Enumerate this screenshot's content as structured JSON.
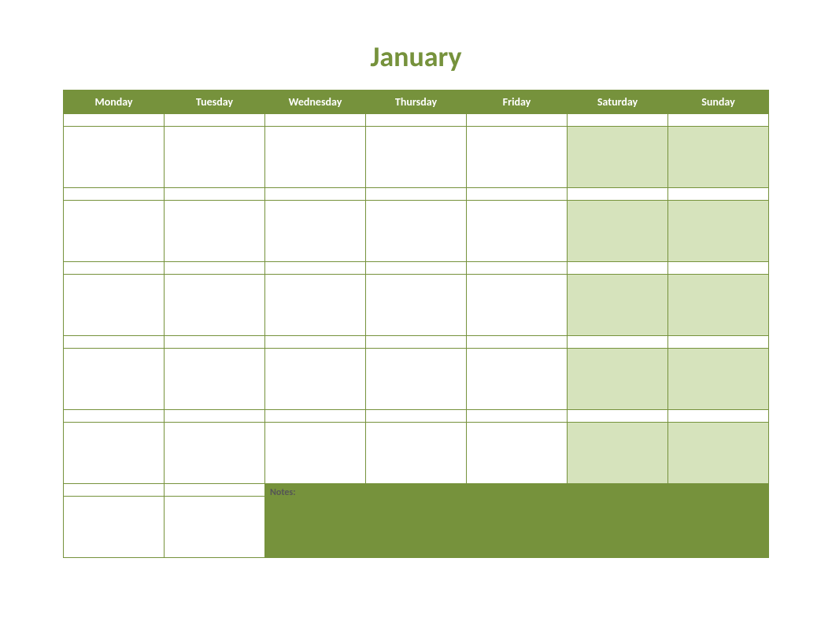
{
  "title": "January",
  "days": [
    "Monday",
    "Tuesday",
    "Wednesday",
    "Thursday",
    "Friday",
    "Saturday",
    "Sunday"
  ],
  "notes_label": "Notes:",
  "colors": {
    "primary": "#76923c",
    "weekend_fill": "#d6e3bc",
    "title_text": "#76923c"
  },
  "grid": {
    "weeks": 6,
    "weekend_columns": [
      5,
      6
    ],
    "last_row_day_cells": 2
  }
}
